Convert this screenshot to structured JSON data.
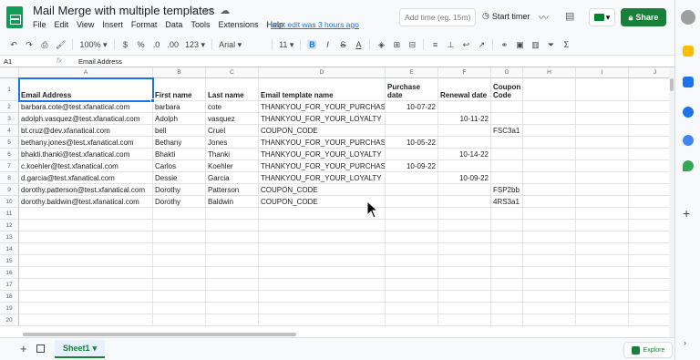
{
  "header": {
    "title": "Mail Merge with multiple templates",
    "title_icons": [
      "☆",
      "▭",
      "☁"
    ],
    "menu": [
      "File",
      "Edit",
      "View",
      "Insert",
      "Format",
      "Data",
      "Tools",
      "Extensions",
      "Help"
    ],
    "last_edit": "Last edit was 3 hours ago",
    "time_placeholder": "Add time (eg. 15m)",
    "start_timer": "Start timer",
    "share": "Share"
  },
  "toolbar": {
    "zoom": "100%",
    "currency": "$",
    "percent": "%",
    "decimal_dec": ".0",
    "decimal_inc": ".00",
    "number_format": "123",
    "font": "Arial",
    "font_size": "11",
    "bold": "B",
    "italic": "I",
    "strike": "S",
    "text_color": "A"
  },
  "formula_bar": {
    "cell_ref": "A1",
    "fx": "fx",
    "content": "Email Address"
  },
  "columns": [
    "A",
    "B",
    "C",
    "D",
    "E",
    "F",
    "G",
    "H",
    "I",
    "J"
  ],
  "row_numbers": [
    "1",
    "2",
    "3",
    "4",
    "5",
    "6",
    "7",
    "8",
    "9",
    "10",
    "11",
    "12",
    "13",
    "14",
    "15",
    "16",
    "17",
    "18",
    "19",
    "20"
  ],
  "headers": [
    "Email Address",
    "First name",
    "Last name",
    "Email template name",
    "Purchase date",
    "Renewal date",
    "Coupon Code"
  ],
  "rows": [
    [
      "barbara.cote@test.xfanatical.com",
      "barbara",
      "cote",
      "THANKYOU_FOR_YOUR_PURCHASE",
      "10-07-22",
      "",
      ""
    ],
    [
      "adolph.vasquez@test.xfanatical.com",
      "Adolph",
      "vasquez",
      "THANKYOU_FOR_YOUR_LOYALTY",
      "",
      "10-11-22",
      ""
    ],
    [
      "bt.cruz@dev.xfanatical.com",
      "bell",
      "Cruel",
      "COUPON_CODE",
      "",
      "",
      "FSC3a1"
    ],
    [
      "bethany.jones@test.xfanatical.com",
      "Bethany",
      "Jones",
      "THANKYOU_FOR_YOUR_PURCHASE",
      "10-05-22",
      "",
      ""
    ],
    [
      "bhakti.thanki@test.xfanatical.com",
      "Bhakti",
      "Thanki",
      "THANKYOU_FOR_YOUR_LOYALTY",
      "",
      "10-14-22",
      ""
    ],
    [
      "c.koehler@test.xfanatical.com",
      "Carlos",
      "Koehler",
      "THANKYOU_FOR_YOUR_PURCHASE",
      "10-09-22",
      "",
      ""
    ],
    [
      "d.garcia@test.xfanatical.com",
      "Dessie",
      "Garcia",
      "THANKYOU_FOR_YOUR_LOYALTY",
      "",
      "10-09-22",
      ""
    ],
    [
      "dorothy.patterson@test.xfanatical.com",
      "Dorothy",
      "Patterson",
      "COUPON_CODE",
      "",
      "",
      "FSP2bb"
    ],
    [
      "dorothy.baldwin@test.xfanatical.com",
      "Dorothy",
      "Baldwin",
      "COUPON_CODE",
      "",
      "",
      "4RS3a1"
    ]
  ],
  "bottom": {
    "sheet_tab": "Sheet1",
    "explore": "Explore"
  },
  "colors": {
    "accent": "#1a73e8",
    "share_green": "#188038",
    "sheets_green": "#0f9d58"
  }
}
